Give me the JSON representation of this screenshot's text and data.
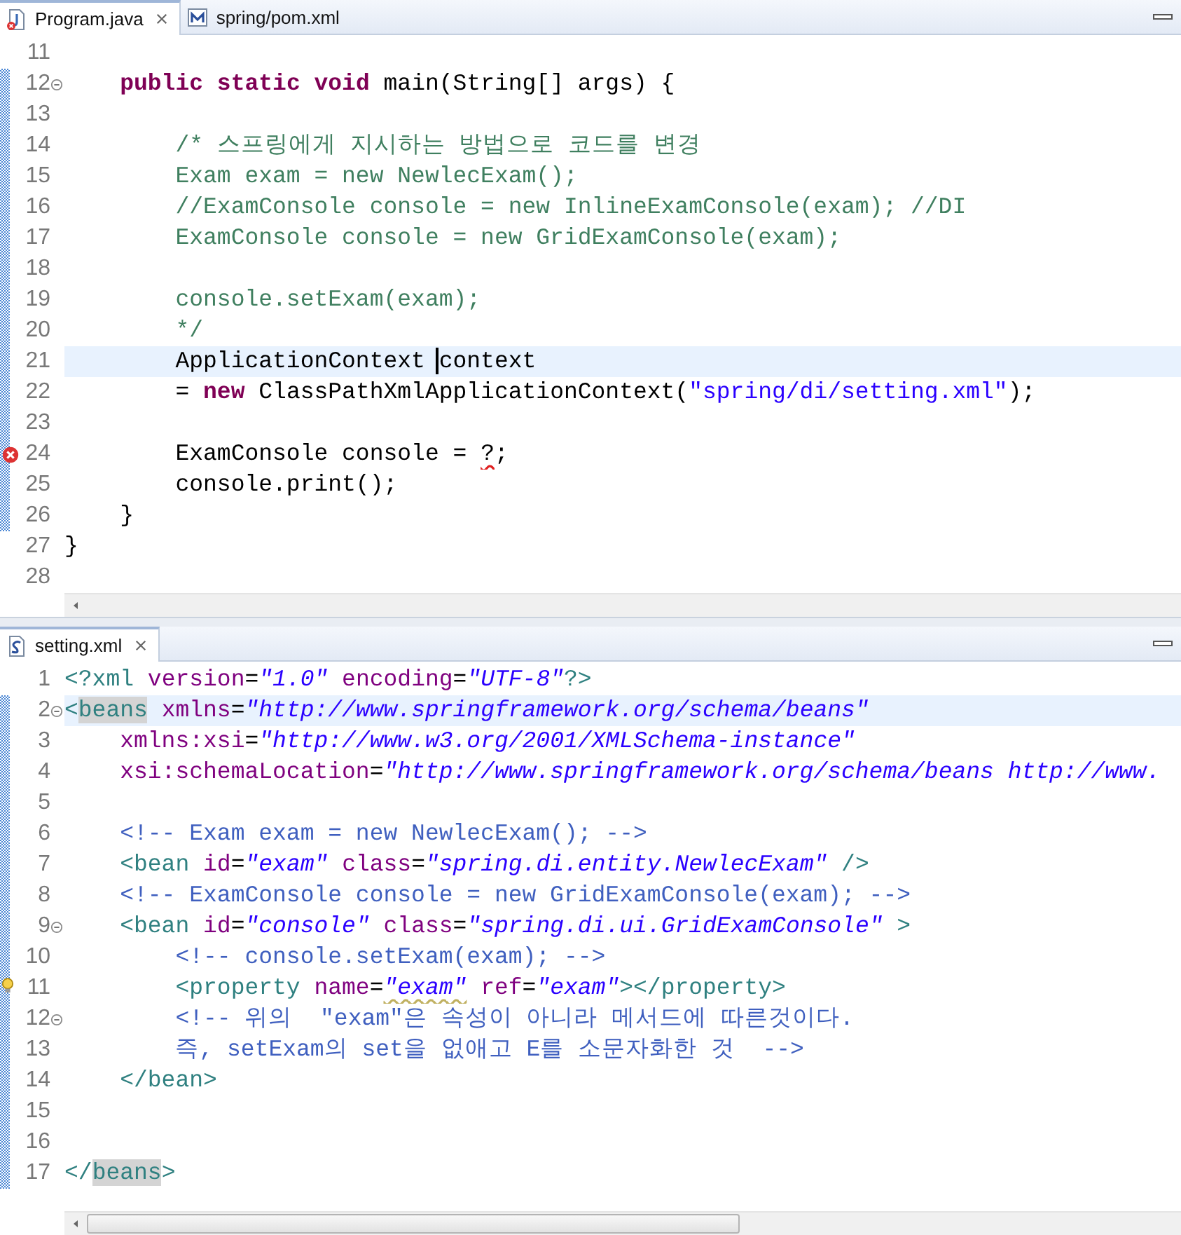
{
  "editors": [
    {
      "tabs": [
        {
          "label": "Program.java",
          "kind": "java",
          "selected": true,
          "closable": true
        },
        {
          "label": "spring/pom.xml",
          "kind": "pom",
          "selected": false,
          "closable": false
        }
      ],
      "lines": [
        {
          "number": "11",
          "changed": false,
          "highlighted": false,
          "fold": false
        },
        {
          "number": "12",
          "changed": true,
          "highlighted": false,
          "fold": true,
          "tokens": [
            {
              "kind": "kw",
              "text": "    public"
            },
            {
              "kind": "kw",
              "text": " static"
            },
            {
              "kind": "kw",
              "text": " void"
            },
            {
              "kind": "plain",
              "text": " main(String[] args) {"
            }
          ]
        },
        {
          "number": "13",
          "changed": true,
          "highlighted": false,
          "fold": false
        },
        {
          "number": "14",
          "changed": true,
          "highlighted": false,
          "fold": false,
          "tokens": [
            {
              "kind": "comment",
              "text": "        /* 스프링에게 지시하는 방법으로 코드를 변경"
            }
          ]
        },
        {
          "number": "15",
          "changed": true,
          "highlighted": false,
          "fold": false,
          "tokens": [
            {
              "kind": "comment",
              "text": "        Exam exam = new NewlecExam();"
            }
          ]
        },
        {
          "number": "16",
          "changed": true,
          "highlighted": false,
          "fold": false,
          "tokens": [
            {
              "kind": "comment",
              "text": "        //ExamConsole console = new InlineExamConsole(exam); //DI"
            }
          ]
        },
        {
          "number": "17",
          "changed": true,
          "highlighted": false,
          "fold": false,
          "tokens": [
            {
              "kind": "comment",
              "text": "        ExamConsole console = new GridExamConsole(exam);"
            }
          ]
        },
        {
          "number": "18",
          "changed": true,
          "highlighted": false,
          "fold": false
        },
        {
          "number": "19",
          "changed": true,
          "highlighted": false,
          "fold": false,
          "tokens": [
            {
              "kind": "comment",
              "text": "        console.setExam(exam);"
            }
          ]
        },
        {
          "number": "20",
          "changed": true,
          "highlighted": false,
          "fold": false,
          "tokens": [
            {
              "kind": "comment",
              "text": "        */"
            }
          ]
        },
        {
          "number": "21",
          "changed": true,
          "highlighted": true,
          "fold": false,
          "tokens": [
            {
              "kind": "plain",
              "text": "        ApplicationContext "
            },
            {
              "kind": "plain",
              "text": "context",
              "caret": true
            }
          ]
        },
        {
          "number": "22",
          "changed": true,
          "highlighted": false,
          "fold": false,
          "tokens": [
            {
              "kind": "plain",
              "text": "        ="
            },
            {
              "kind": "kw",
              "text": " new"
            },
            {
              "kind": "plain",
              "text": " ClassPathXmlApplicationContext("
            },
            {
              "kind": "str",
              "text": "\"spring/di/setting.xml\""
            },
            {
              "kind": "plain",
              "text": ");"
            }
          ]
        },
        {
          "number": "23",
          "changed": true,
          "highlighted": false,
          "fold": false
        },
        {
          "number": "24",
          "changed": true,
          "highlighted": false,
          "fold": false,
          "error": true,
          "tokens": [
            {
              "kind": "plain",
              "text": "        ExamConsole console = "
            },
            {
              "kind": "plain",
              "text": "?",
              "squiggle": true
            },
            {
              "kind": "plain",
              "text": ";"
            }
          ]
        },
        {
          "number": "25",
          "changed": true,
          "highlighted": false,
          "fold": false,
          "tokens": [
            {
              "kind": "plain",
              "text": "        console.print();"
            }
          ]
        },
        {
          "number": "26",
          "changed": true,
          "highlighted": false,
          "fold": false,
          "tokens": [
            {
              "kind": "plain",
              "text": "    }"
            }
          ]
        },
        {
          "number": "27",
          "changed": false,
          "highlighted": false,
          "fold": false,
          "tokens": [
            {
              "kind": "plain",
              "text": "}"
            }
          ]
        },
        {
          "number": "28",
          "changed": false,
          "highlighted": false,
          "fold": false
        }
      ]
    },
    {
      "tabs": [
        {
          "label": "setting.xml",
          "kind": "xml",
          "selected": true,
          "closable": true
        }
      ],
      "lines": [
        {
          "number": "1",
          "changed": false,
          "highlighted": false,
          "fold": false,
          "tokens": [
            {
              "kind": "tag",
              "text": "<?xml"
            },
            {
              "kind": "attr",
              "text": " version"
            },
            {
              "kind": "plain",
              "text": "="
            },
            {
              "kind": "val",
              "text": "\"1.0\""
            },
            {
              "kind": "attr",
              "text": " encoding"
            },
            {
              "kind": "plain",
              "text": "="
            },
            {
              "kind": "val",
              "text": "\"UTF-8\""
            },
            {
              "kind": "tag",
              "text": "?>"
            }
          ]
        },
        {
          "number": "2",
          "changed": true,
          "highlighted": true,
          "fold": true,
          "tokens": [
            {
              "kind": "tag",
              "text": "<"
            },
            {
              "kind": "tag",
              "text": "beans",
              "match": true
            },
            {
              "kind": "attr",
              "text": " xmlns"
            },
            {
              "kind": "plain",
              "text": "="
            },
            {
              "kind": "val",
              "text": "\"http://www.springframework.org/schema/beans\""
            }
          ]
        },
        {
          "number": "3",
          "changed": true,
          "highlighted": false,
          "fold": false,
          "tokens": [
            {
              "kind": "attr",
              "text": "    xmlns:xsi"
            },
            {
              "kind": "plain",
              "text": "="
            },
            {
              "kind": "val",
              "text": "\"http://www.w3.org/2001/XMLSchema-instance\""
            }
          ]
        },
        {
          "number": "4",
          "changed": true,
          "highlighted": false,
          "fold": false,
          "tokens": [
            {
              "kind": "attr",
              "text": "    xsi:schemaLocation"
            },
            {
              "kind": "plain",
              "text": "="
            },
            {
              "kind": "val",
              "text": "\"http://www.springframework.org/schema/beans http://www."
            }
          ]
        },
        {
          "number": "5",
          "changed": true,
          "highlighted": false,
          "fold": false
        },
        {
          "number": "6",
          "changed": true,
          "highlighted": false,
          "fold": false,
          "tokens": [
            {
              "kind": "xcomment",
              "text": "    <!-- Exam exam = new NewlecExam(); -->"
            }
          ]
        },
        {
          "number": "7",
          "changed": true,
          "highlighted": false,
          "fold": false,
          "tokens": [
            {
              "kind": "tag",
              "text": "    <bean"
            },
            {
              "kind": "attr",
              "text": " id"
            },
            {
              "kind": "plain",
              "text": "="
            },
            {
              "kind": "val",
              "text": "\"exam\""
            },
            {
              "kind": "attr",
              "text": " class"
            },
            {
              "kind": "plain",
              "text": "="
            },
            {
              "kind": "val",
              "text": "\"spring.di.entity.NewlecExam\""
            },
            {
              "kind": "tag",
              "text": " />"
            }
          ]
        },
        {
          "number": "8",
          "changed": true,
          "highlighted": false,
          "fold": false,
          "tokens": [
            {
              "kind": "xcomment",
              "text": "    <!-- ExamConsole console = new GridExamConsole(exam); -->"
            }
          ]
        },
        {
          "number": "9",
          "changed": true,
          "highlighted": false,
          "fold": true,
          "tokens": [
            {
              "kind": "tag",
              "text": "    <bean"
            },
            {
              "kind": "attr",
              "text": " id"
            },
            {
              "kind": "plain",
              "text": "="
            },
            {
              "kind": "val",
              "text": "\"console\""
            },
            {
              "kind": "attr",
              "text": " class"
            },
            {
              "kind": "plain",
              "text": "="
            },
            {
              "kind": "val",
              "text": "\"spring.di.ui.GridExamConsole\""
            },
            {
              "kind": "tag",
              "text": " >"
            }
          ]
        },
        {
          "number": "10",
          "changed": true,
          "highlighted": false,
          "fold": false,
          "tokens": [
            {
              "kind": "xcomment",
              "text": "        <!-- console.setExam(exam); -->"
            }
          ]
        },
        {
          "number": "11",
          "changed": true,
          "highlighted": false,
          "fold": false,
          "warning": true,
          "tokens": [
            {
              "kind": "tag",
              "text": "        <property"
            },
            {
              "kind": "attr",
              "text": " name"
            },
            {
              "kind": "plain",
              "text": "="
            },
            {
              "kind": "val",
              "text": "\"exam\"",
              "squiggle": true
            },
            {
              "kind": "attr",
              "text": " ref"
            },
            {
              "kind": "plain",
              "text": "="
            },
            {
              "kind": "val",
              "text": "\"exam\""
            },
            {
              "kind": "tag",
              "text": "></property>"
            }
          ]
        },
        {
          "number": "12",
          "changed": true,
          "highlighted": false,
          "fold": true,
          "tokens": [
            {
              "kind": "xcomment",
              "text": "        <!-- 위의  \"exam\"은 속성이 아니라 메서드에 따른것이다."
            }
          ]
        },
        {
          "number": "13",
          "changed": true,
          "highlighted": false,
          "fold": false,
          "tokens": [
            {
              "kind": "xcomment",
              "text": "        즉, setExam의 set을 없애고 E를 소문자화한 것  -->"
            }
          ]
        },
        {
          "number": "14",
          "changed": true,
          "highlighted": false,
          "fold": false,
          "tokens": [
            {
              "kind": "tag",
              "text": "    </bean>"
            }
          ]
        },
        {
          "number": "15",
          "changed": true,
          "highlighted": false,
          "fold": false
        },
        {
          "number": "16",
          "changed": true,
          "highlighted": false,
          "fold": false
        },
        {
          "number": "17",
          "changed": true,
          "highlighted": false,
          "fold": false,
          "tokens": [
            {
              "kind": "tag",
              "text": "</"
            },
            {
              "kind": "tag",
              "text": "beans",
              "match": true
            },
            {
              "kind": "tag",
              "text": ">"
            }
          ]
        }
      ]
    }
  ]
}
